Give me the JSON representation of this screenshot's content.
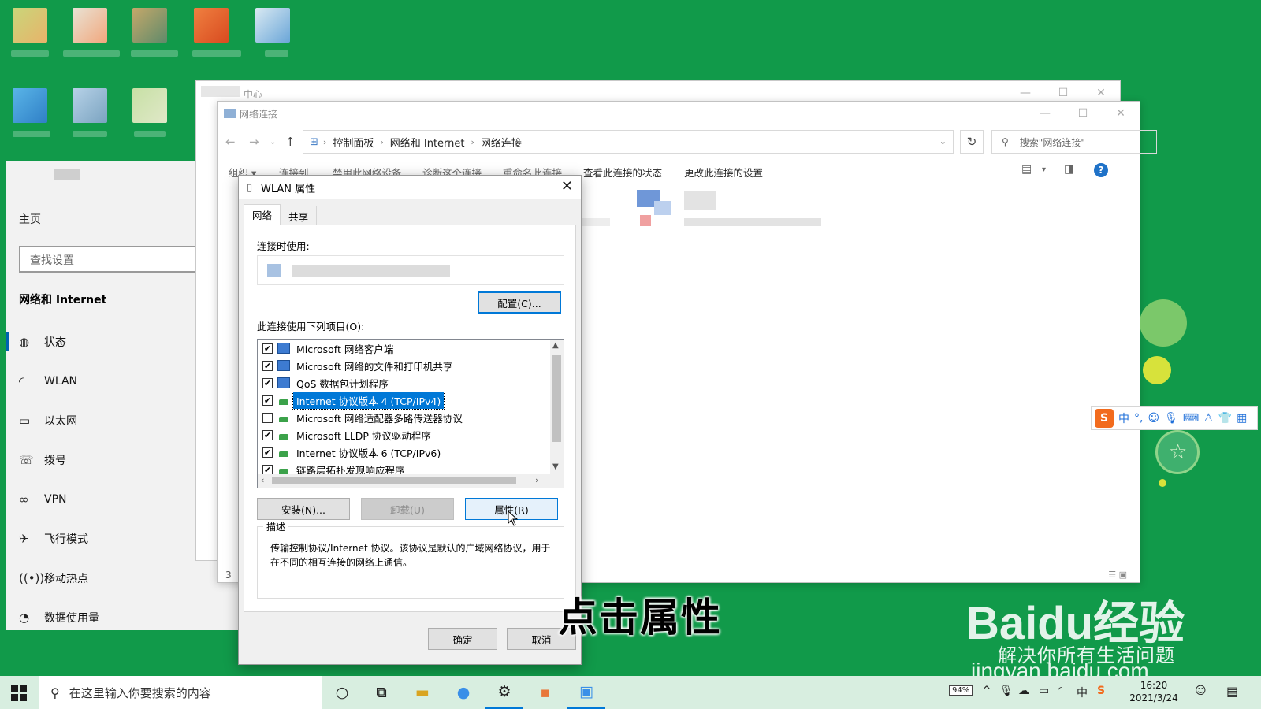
{
  "settings": {
    "home_label": "主页",
    "search_placeholder": "查找设置",
    "section_title": "网络和 Internet",
    "nav": [
      {
        "icon": "status-icon",
        "label": "状态"
      },
      {
        "icon": "wifi-icon",
        "label": "WLAN"
      },
      {
        "icon": "ethernet-icon",
        "label": "以太网"
      },
      {
        "icon": "dialup-icon",
        "label": "拨号"
      },
      {
        "icon": "vpn-icon",
        "label": "VPN"
      },
      {
        "icon": "airplane-icon",
        "label": "飞行模式"
      },
      {
        "icon": "hotspot-icon",
        "label": "移动热点"
      },
      {
        "icon": "data-usage-icon",
        "label": "数据使用量"
      }
    ]
  },
  "back_window": {
    "title": "中心"
  },
  "explorer": {
    "title": "网络连接",
    "breadcrumb": [
      "控制面板",
      "网络和 Internet",
      "网络连接"
    ],
    "search_placeholder": "搜索\"网络连接\"",
    "commands": [
      "组织 ▾",
      "连接到",
      "禁用此网络设备",
      "诊断这个连接",
      "重命名此连接",
      "查看此连接的状态",
      "更改此连接的设置"
    ],
    "status_count": "3"
  },
  "dialog": {
    "title": "WLAN 属性",
    "tabs": [
      "网络",
      "共享"
    ],
    "connect_using_label": "连接时使用:",
    "configure_button": "配置(C)...",
    "items_label": "此连接使用下列项目(O):",
    "items": [
      {
        "checked": true,
        "icon": "pc",
        "label": "Microsoft 网络客户端"
      },
      {
        "checked": true,
        "icon": "pc",
        "label": "Microsoft 网络的文件和打印机共享"
      },
      {
        "checked": true,
        "icon": "pc",
        "label": "QoS 数据包计划程序"
      },
      {
        "checked": true,
        "icon": "net",
        "label": "Internet 协议版本 4 (TCP/IPv4)",
        "selected": true
      },
      {
        "checked": false,
        "icon": "net",
        "label": "Microsoft 网络适配器多路传送器协议"
      },
      {
        "checked": true,
        "icon": "net",
        "label": "Microsoft LLDP 协议驱动程序"
      },
      {
        "checked": true,
        "icon": "net",
        "label": "Internet 协议版本 6 (TCP/IPv6)"
      },
      {
        "checked": true,
        "icon": "net",
        "label": "链路层拓扑发现响应程序"
      }
    ],
    "install_button": "安装(N)...",
    "uninstall_button": "卸载(U)",
    "properties_button": "属性(R)",
    "description_label": "描述",
    "description_text": "传输控制协议/Internet 协议。该协议是默认的广域网络协议，用于在不同的相互连接的网络上通信。",
    "ok_button": "确定",
    "cancel_button": "取消"
  },
  "ime": {
    "mode": "中",
    "punct": "°,"
  },
  "overlay": {
    "subtitle": "点击属性",
    "watermark_brand": "Baidu经验",
    "watermark_slogan": "解决你所有生活问题",
    "watermark_url": "jingyan.baidu.com"
  },
  "taskbar": {
    "search_placeholder": "在这里输入你要搜索的内容",
    "battery": "94%",
    "time": "16:20",
    "date": "2021/3/24"
  },
  "colors": {
    "desktop": "#119a4a",
    "accent": "#0078d7",
    "selection": "#0078d7"
  }
}
